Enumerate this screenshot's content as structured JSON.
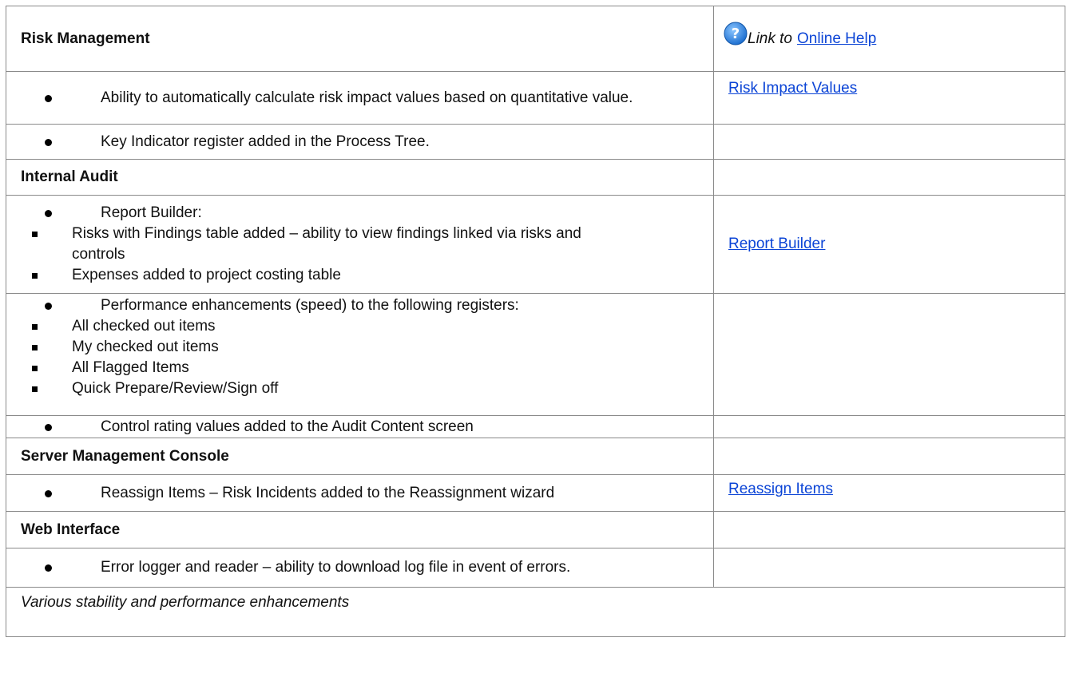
{
  "header": {
    "title": "Risk Management",
    "link_prefix": "Link to",
    "link_label": "Online Help",
    "help_icon": "question-circle-icon"
  },
  "risk": {
    "item1": "Ability to automatically calculate risk impact values based on quantitative value.",
    "item1_link": "Risk Impact Values",
    "item2": "Key Indicator register added in the Process Tree."
  },
  "audit": {
    "title": "Internal Audit",
    "report_builder": "Report Builder:",
    "sub1": "Risks with Findings table added – ability to view findings linked via risks and controls",
    "sub2": "Expenses added to project costing table",
    "report_link": "Report Builder",
    "perf": "Performance enhancements (speed) to the following registers:",
    "perf_items": [
      "All checked out items",
      "My checked out items",
      "All Flagged Items",
      "Quick Prepare/Review/Sign off"
    ],
    "control": "Control rating values added to the Audit Content screen"
  },
  "server": {
    "title": "Server Management Console",
    "item": "Reassign Items – Risk Incidents added to the Reassignment wizard",
    "link": "Reassign Items"
  },
  "web": {
    "title": "Web Interface",
    "item": "Error logger and reader – ability to download log file in event of errors."
  },
  "footer": "Various stability and performance enhancements",
  "colors": {
    "link": "#0b44d6",
    "border": "#8a8a8a",
    "icon": "#2f86e0"
  }
}
